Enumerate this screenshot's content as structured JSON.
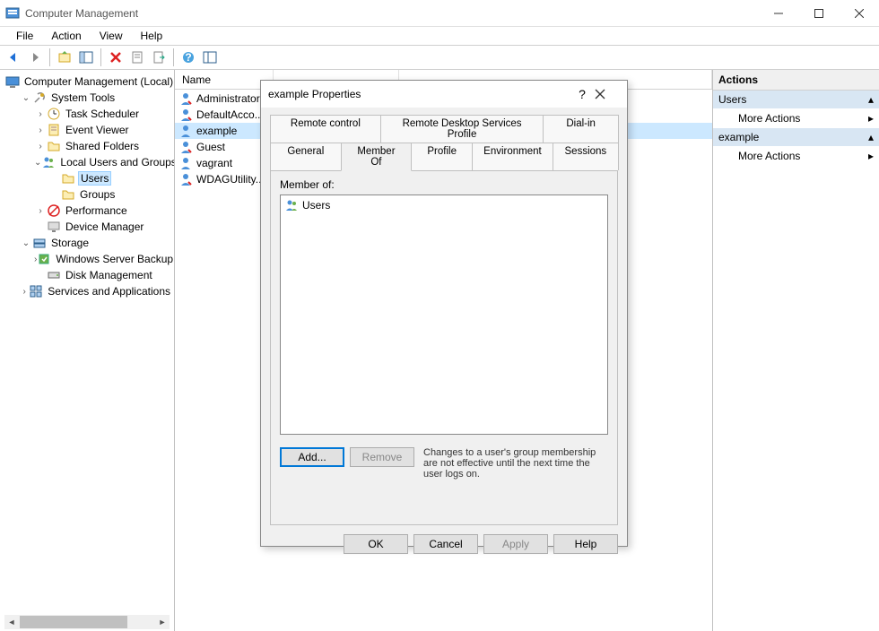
{
  "window": {
    "title": "Computer Management"
  },
  "menu": {
    "file": "File",
    "action": "Action",
    "view": "View",
    "help": "Help"
  },
  "tree": {
    "root": "Computer Management (Local)",
    "system_tools": "System Tools",
    "task_scheduler": "Task Scheduler",
    "event_viewer": "Event Viewer",
    "shared_folders": "Shared Folders",
    "local_users": "Local Users and Groups",
    "users": "Users",
    "groups": "Groups",
    "performance": "Performance",
    "device_manager": "Device Manager",
    "storage": "Storage",
    "server_backup": "Windows Server Backup",
    "disk_mgmt": "Disk Management",
    "services_apps": "Services and Applications"
  },
  "list": {
    "col_name": "Name",
    "rows": [
      {
        "name": "Administrator"
      },
      {
        "name": "DefaultAcco..."
      },
      {
        "name": "example"
      },
      {
        "name": "Guest"
      },
      {
        "name": "vagrant"
      },
      {
        "name": "WDAGUtility..."
      }
    ]
  },
  "actions": {
    "header": "Actions",
    "section1": "Users",
    "section2": "example",
    "more": "More Actions"
  },
  "dialog": {
    "title": "example Properties",
    "tabs": {
      "remote_control": "Remote control",
      "rds_profile": "Remote Desktop Services Profile",
      "dialin": "Dial-in",
      "general": "General",
      "member_of": "Member Of",
      "profile": "Profile",
      "environment": "Environment",
      "sessions": "Sessions"
    },
    "member_of_label": "Member of:",
    "members": [
      "Users"
    ],
    "add": "Add...",
    "remove": "Remove",
    "hint": "Changes to a user's group membership are not effective until the next time the user logs on.",
    "ok": "OK",
    "cancel": "Cancel",
    "apply": "Apply",
    "help": "Help"
  }
}
